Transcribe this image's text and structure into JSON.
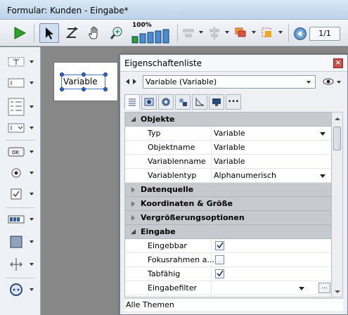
{
  "window": {
    "title": "Formular: Kunden -  Eingabe*"
  },
  "toolbar": {
    "zoom_label": "100%",
    "page_indicator": "1/1",
    "tools": [
      "run-icon",
      "arrow-select-icon",
      "tab-order-icon",
      "hand-icon",
      "zoom-icon",
      "bar-zoom-icon",
      "align-icon",
      "distribute-icon",
      "layers-icon",
      "selection-icon",
      "prev-page-icon"
    ]
  },
  "left_toolbox": {
    "tools": [
      "text-object-icon",
      "field-icon",
      "list-icon",
      "dropdown-field-icon",
      "ok-button-icon",
      "radio-icon",
      "checkbox-icon",
      "progress-bar-icon",
      "rectangle-icon",
      "splitter-icon",
      "plugin-icon"
    ]
  },
  "form": {
    "variable_label": "Variable"
  },
  "panel": {
    "title": "Eigenschaftenliste",
    "object_selector": "Variable (Variable)",
    "tabs": [
      "list-tab-icon",
      "object-tab-icon",
      "settings-tab-icon",
      "shapes-tab-icon",
      "chart-tab-icon",
      "display-tab-icon",
      "more-tab-icon"
    ],
    "more_tab_label": "•••",
    "groups": [
      {
        "name": "Objekte",
        "expanded": true,
        "rows": [
          {
            "prop": "Typ",
            "value": "Variable",
            "dropdown": true
          },
          {
            "prop": "Objektname",
            "value": "Variable"
          },
          {
            "prop": "Variablenname",
            "value": "Variable"
          },
          {
            "prop": "Variablentyp",
            "value": "Alphanumerisch",
            "dropdown": true
          }
        ]
      },
      {
        "name": "Datenquelle",
        "expanded": false
      },
      {
        "name": "Koordinaten & Größe",
        "expanded": false
      },
      {
        "name": "Vergrößerungsoptionen",
        "expanded": false
      },
      {
        "name": "Eingabe",
        "expanded": true,
        "rows": [
          {
            "prop": "Eingebbar",
            "checked": true
          },
          {
            "prop": "Fokusrahmen a...",
            "checked": false
          },
          {
            "prop": "Tabfähig",
            "checked": true
          },
          {
            "prop": "Eingabefilter",
            "value": "",
            "dropdown": true,
            "ellipsis": "..."
          }
        ]
      }
    ],
    "status": "Alle Themen"
  }
}
